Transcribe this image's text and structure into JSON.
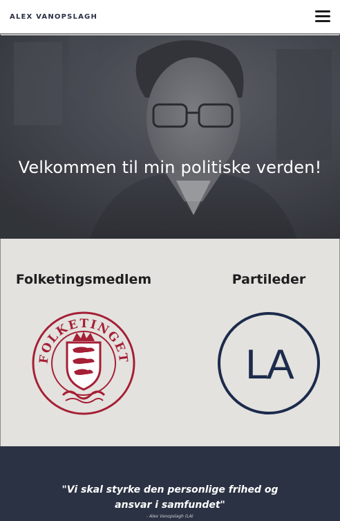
{
  "navbar": {
    "brand": "ALEX VANOPSLAGH",
    "menu_icon": "hamburger-menu-icon"
  },
  "hero": {
    "title": "Velkommen til min politiske verden!"
  },
  "roles": [
    {
      "title": "Folketingsmedlem",
      "logo_text": "FOLKETINGET",
      "logo_color": "#a51f35"
    },
    {
      "title": "Partileder",
      "logo_text": "LA",
      "logo_color": "#1c2b4c"
    }
  ],
  "quote": {
    "text": "\"Vi skal styrke den personlige frihed og ansvar i samfundet\"",
    "author": "- Alex Vanopslagh (LA)"
  },
  "colors": {
    "navbar_bg": "#ffffff",
    "roles_bg": "#e3e2de",
    "quote_bg": "#2b3243",
    "folketinget_red": "#a51f35",
    "la_navy": "#1c2b4c"
  }
}
